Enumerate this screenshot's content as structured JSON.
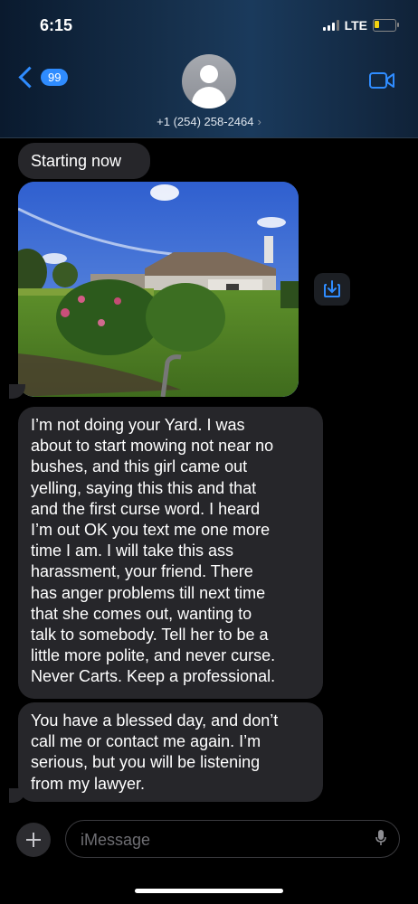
{
  "status_bar": {
    "time": "6:15",
    "network": "LTE",
    "battery_level": 0.25
  },
  "header": {
    "back_badge": "99",
    "contact_number": "+1 (254) 258-2464",
    "contact_arrow": "›",
    "accent_color": "#2f8cff"
  },
  "messages": [
    {
      "type": "text",
      "text": "Starting now"
    },
    {
      "type": "image",
      "description_icon": "photo-attachment"
    },
    {
      "type": "text",
      "text": "I’m not doing your Yard. I was\nabout to start mowing not near no\nbushes, and this girl came out\nyelling, saying this this and that\nand the first curse word. I heard\nI’m out OK you text me one more\ntime I am. I will take this ass\nharassment, your friend. There\nhas anger problems till next time\nthat she comes out, wanting to\ntalk to somebody. Tell her to be a\nlittle more polite, and never curse.\nNever Carts. Keep a professional."
    },
    {
      "type": "text",
      "text": "You have a blessed day, and don’t\ncall me or contact me again. I’m\nserious, but you will be listening\nfrom my lawyer."
    }
  ],
  "composer": {
    "placeholder": "iMessage"
  },
  "icons": [
    "back-chevron-icon",
    "avatar-icon",
    "video-call-icon",
    "save-icon",
    "plus-icon",
    "mic-icon"
  ]
}
